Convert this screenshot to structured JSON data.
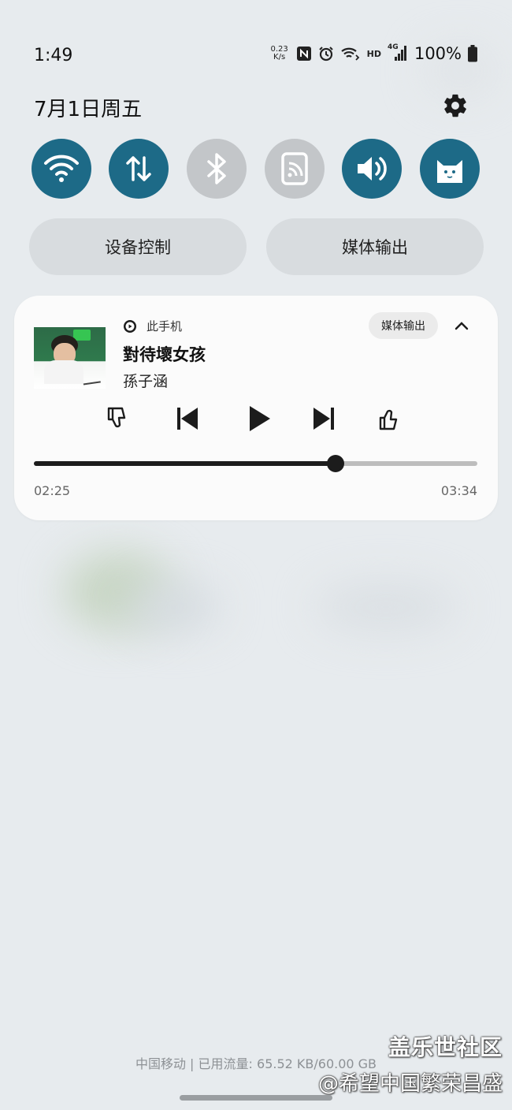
{
  "status_bar": {
    "time": "1:49",
    "net_speed_value": "0.23",
    "net_speed_unit": "K/s",
    "hd_label": "HD",
    "network_type": "4G",
    "battery": "100%",
    "icons": [
      "nfc-icon",
      "alarm-icon",
      "wifi-call-icon",
      "hd-icon",
      "signal-4g-icon",
      "battery-icon"
    ]
  },
  "header": {
    "date": "7月1日周五"
  },
  "quick_settings": [
    {
      "name": "wifi",
      "icon": "wifi-icon",
      "active": true
    },
    {
      "name": "mobile-data",
      "icon": "data-arrows-icon",
      "active": true
    },
    {
      "name": "bluetooth",
      "icon": "bluetooth-icon",
      "active": false
    },
    {
      "name": "nfc",
      "icon": "nfc-icon",
      "active": false
    },
    {
      "name": "sound",
      "icon": "volume-icon",
      "active": true
    },
    {
      "name": "cat-app",
      "icon": "cat-icon",
      "active": true
    }
  ],
  "wide_buttons": {
    "device_control": "设备控制",
    "media_output": "媒体输出"
  },
  "media": {
    "source": "此手机",
    "output_label": "媒体输出",
    "title": "對待壞女孩",
    "artist": "孫子涵",
    "elapsed": "02:25",
    "total": "03:34",
    "progress": 0.68
  },
  "footer": {
    "carrier_info": "中国移动 | 已用流量: 65.52 KB/60.00 GB",
    "watermark_line1": "盖乐世社区",
    "watermark_line2": "@希望中国繁荣昌盛"
  },
  "colors": {
    "accent": "#1d6a87",
    "inactive": "#c3c6c9",
    "background": "#e7ebee"
  }
}
